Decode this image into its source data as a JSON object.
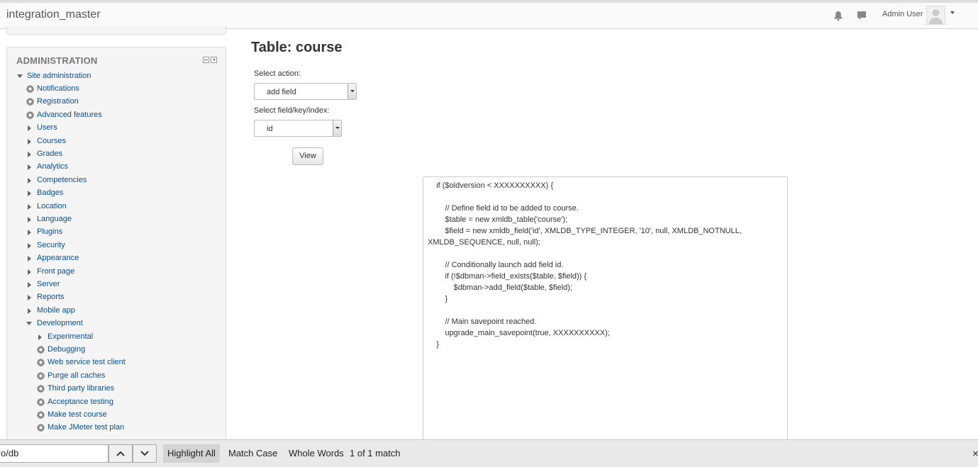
{
  "app": {
    "title": "integration_master"
  },
  "header": {
    "user_name": "Admin User",
    "icons": [
      "bell-icon",
      "chat-icon",
      "avatar",
      "chevron-down-icon"
    ]
  },
  "sidebar": {
    "block_title": "ADMINISTRATION",
    "root_label": "Site administration",
    "items": [
      {
        "label": "Notifications",
        "icon": "gear-icon"
      },
      {
        "label": "Registration",
        "icon": "gear-icon"
      },
      {
        "label": "Advanced features",
        "icon": "gear-icon"
      },
      {
        "label": "Users",
        "icon": "expand-arrow"
      },
      {
        "label": "Courses",
        "icon": "expand-arrow"
      },
      {
        "label": "Grades",
        "icon": "expand-arrow"
      },
      {
        "label": "Analytics",
        "icon": "expand-arrow"
      },
      {
        "label": "Competencies",
        "icon": "expand-arrow"
      },
      {
        "label": "Badges",
        "icon": "expand-arrow"
      },
      {
        "label": "Location",
        "icon": "expand-arrow"
      },
      {
        "label": "Language",
        "icon": "expand-arrow"
      },
      {
        "label": "Plugins",
        "icon": "expand-arrow"
      },
      {
        "label": "Security",
        "icon": "expand-arrow"
      },
      {
        "label": "Appearance",
        "icon": "expand-arrow"
      },
      {
        "label": "Front page",
        "icon": "expand-arrow"
      },
      {
        "label": "Server",
        "icon": "expand-arrow"
      },
      {
        "label": "Reports",
        "icon": "expand-arrow"
      },
      {
        "label": "Mobile app",
        "icon": "expand-arrow"
      },
      {
        "label": "Development",
        "icon": "collapse-arrow"
      }
    ],
    "dev_items": [
      {
        "label": "Experimental",
        "icon": "expand-arrow"
      },
      {
        "label": "Debugging",
        "icon": "gear-icon"
      },
      {
        "label": "Web service test client",
        "icon": "gear-icon"
      },
      {
        "label": "Purge all caches",
        "icon": "gear-icon"
      },
      {
        "label": "Third party libraries",
        "icon": "gear-icon"
      },
      {
        "label": "Acceptance testing",
        "icon": "gear-icon"
      },
      {
        "label": "Make test course",
        "icon": "gear-icon"
      },
      {
        "label": "Make JMeter test plan",
        "icon": "gear-icon"
      }
    ]
  },
  "main": {
    "title": "Table: course",
    "action_label": "Select action:",
    "action_value": "add field",
    "field_label": "Select field/key/index:",
    "field_value": "id",
    "view_button": "View",
    "code_lines": [
      "    if ($oldversion < XXXXXXXXXX) {",
      "",
      "        // Define field id to be added to course.",
      "        $table = new xmldb_table('course');",
      "        $field = new xmldb_field('id', XMLDB_TYPE_INTEGER, '10', null, XMLDB_NOTNULL,",
      "XMLDB_SEQUENCE, null, null);",
      "",
      "        // Conditionally launch add field id.",
      "        if (!$dbman->field_exists($table, $field)) {",
      "            $dbman->add_field($table, $field);",
      "        }",
      "",
      "        // Main savepoint reached.",
      "        upgrade_main_savepoint(true, XXXXXXXXXX);",
      "    }"
    ]
  },
  "findbar": {
    "query": "o/db",
    "highlight_all": "Highlight All",
    "match_case": "Match Case",
    "whole_words": "Whole Words",
    "status": "1 of 1 match",
    "close": "×"
  }
}
